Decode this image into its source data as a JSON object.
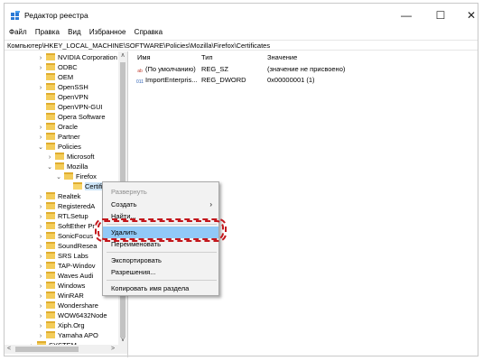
{
  "window": {
    "title": "Редактор реестра",
    "controls": [
      "—",
      "☐",
      "✕"
    ]
  },
  "menubar": [
    "Файл",
    "Правка",
    "Вид",
    "Избранное",
    "Справка"
  ],
  "address": "Компьютер\\HKEY_LOCAL_MACHINE\\SOFTWARE\\Policies\\Mozilla\\Firefox\\Certificates",
  "tree": [
    {
      "label": "NVIDIA Corporation",
      "exp": "›"
    },
    {
      "label": "ODBC",
      "exp": "›"
    },
    {
      "label": "OEM",
      "exp": ""
    },
    {
      "label": "OpenSSH",
      "exp": "›"
    },
    {
      "label": "OpenVPN",
      "exp": ""
    },
    {
      "label": "OpenVPN-GUI",
      "exp": ""
    },
    {
      "label": "Opera Software",
      "exp": ""
    },
    {
      "label": "Oracle",
      "exp": "›"
    },
    {
      "label": "Partner",
      "exp": "›"
    },
    {
      "label": "Policies",
      "exp": "⌄"
    },
    {
      "label": "Microsoft",
      "exp": "›"
    },
    {
      "label": "Mozilla",
      "exp": "⌄"
    },
    {
      "label": "Firefox",
      "exp": "⌄"
    },
    {
      "label": "Certificates",
      "exp": ""
    },
    {
      "label": "Realtek",
      "exp": "›"
    },
    {
      "label": "RegisteredA",
      "exp": "›"
    },
    {
      "label": "RTLSetup",
      "exp": "›"
    },
    {
      "label": "SoftEther Pr",
      "exp": "›"
    },
    {
      "label": "SonicFocus",
      "exp": "›"
    },
    {
      "label": "SoundResea",
      "exp": "›"
    },
    {
      "label": "SRS Labs",
      "exp": "›"
    },
    {
      "label": "TAP-Windov",
      "exp": "›"
    },
    {
      "label": "Waves Audi",
      "exp": "›"
    },
    {
      "label": "Windows",
      "exp": "›"
    },
    {
      "label": "WinRAR",
      "exp": "›"
    },
    {
      "label": "Wondershare",
      "exp": "›"
    },
    {
      "label": "WOW6432Node",
      "exp": "›"
    },
    {
      "label": "Xiph.Org",
      "exp": "›"
    },
    {
      "label": "Yamaha APO",
      "exp": "›"
    },
    {
      "label": "SYSTEM",
      "exp": "›"
    }
  ],
  "columns": {
    "name": "Имя",
    "type": "Тип",
    "value": "Значение"
  },
  "values": [
    {
      "icon": "ab",
      "name": "(По умолчанию)",
      "type": "REG_SZ",
      "data": "(значение не присвоено)"
    },
    {
      "icon": "011",
      "name": "ImportEnterpris...",
      "type": "REG_DWORD",
      "data": "0x00000001 (1)"
    }
  ],
  "context_menu": {
    "expand": "Развернуть",
    "create": "Создать",
    "create_arrow": "›",
    "find": "Найти...",
    "delete": "Удалить",
    "rename": "Переименовать",
    "export": "Экспортировать",
    "permissions": "Разрешения...",
    "copy_name": "Копировать имя раздела"
  },
  "scroll": {
    "up": "∧",
    "down": "∨",
    "left": "<",
    "right": ">"
  }
}
